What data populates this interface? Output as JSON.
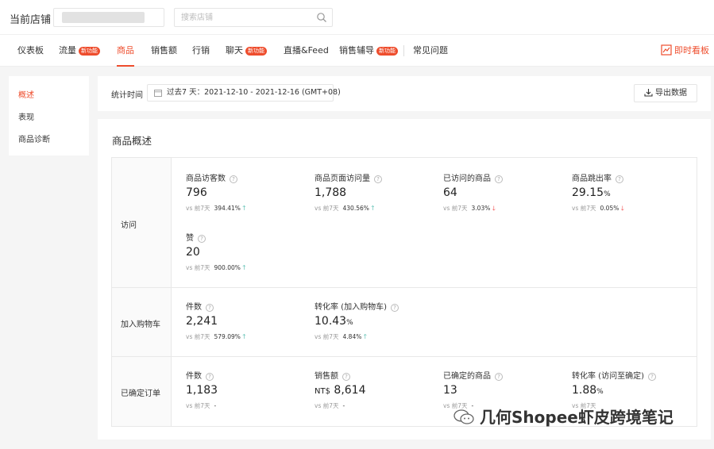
{
  "header": {
    "shop_label": "当前店铺",
    "search_placeholder": "搜索店铺"
  },
  "nav": {
    "items": [
      {
        "label": "仪表板"
      },
      {
        "label": "流量",
        "badge": "新功能"
      },
      {
        "label": "商品"
      },
      {
        "label": "销售额"
      },
      {
        "label": "行销"
      },
      {
        "label": "聊天",
        "badge": "新功能"
      },
      {
        "label": "直播&Feed"
      },
      {
        "label": "销售辅导",
        "badge": "新功能"
      },
      {
        "label": "常见问题"
      }
    ],
    "live_label": "即时看板"
  },
  "sidebar": {
    "items": [
      {
        "label": "概述"
      },
      {
        "label": "表现"
      },
      {
        "label": "商品诊断"
      }
    ]
  },
  "filter": {
    "label": "统计时间",
    "date_range": "过去7 天：2021-12-10 - 2021-12-16 (GMT+08)",
    "export_label": "导出数据"
  },
  "overview": {
    "title": "商品概述",
    "compare_label": "vs 前7天",
    "sections": [
      {
        "label": "访问",
        "metrics": [
          {
            "name": "商品访客数",
            "value": "796",
            "change": "394.41%",
            "trend": "up"
          },
          {
            "name": "商品页面访问量",
            "value": "1,788",
            "change": "430.56%",
            "trend": "up"
          },
          {
            "name": "已访问的商品",
            "value": "64",
            "change": "3.03%",
            "trend": "down"
          },
          {
            "name": "商品跳出率",
            "value": "29.15",
            "unit": "%",
            "change": "0.05%",
            "trend": "down"
          },
          {
            "name": "赞",
            "value": "20",
            "change": "900.00%",
            "trend": "up"
          }
        ]
      },
      {
        "label": "加入购物车",
        "metrics": [
          {
            "name": "件数",
            "value": "2,241",
            "change": "579.09%",
            "trend": "up"
          },
          {
            "name": "转化率 (加入购物车)",
            "value": "10.43",
            "unit": "%",
            "change": "4.84%",
            "trend": "up"
          }
        ]
      },
      {
        "label": "已确定订单",
        "metrics": [
          {
            "name": "件数",
            "value": "1,183",
            "change": "-",
            "trend": "none"
          },
          {
            "name": "销售额",
            "currency": "NT$",
            "value": "8,614",
            "change": "-",
            "trend": "none"
          },
          {
            "name": "已确定的商品",
            "value": "13",
            "change": "-",
            "trend": "none"
          },
          {
            "name": "转化率 (访问至确定)",
            "value": "1.88",
            "unit": "%",
            "change": "",
            "trend": "none"
          }
        ]
      }
    ]
  },
  "watermark": {
    "text": "几何Shopee虾皮跨境笔记"
  }
}
